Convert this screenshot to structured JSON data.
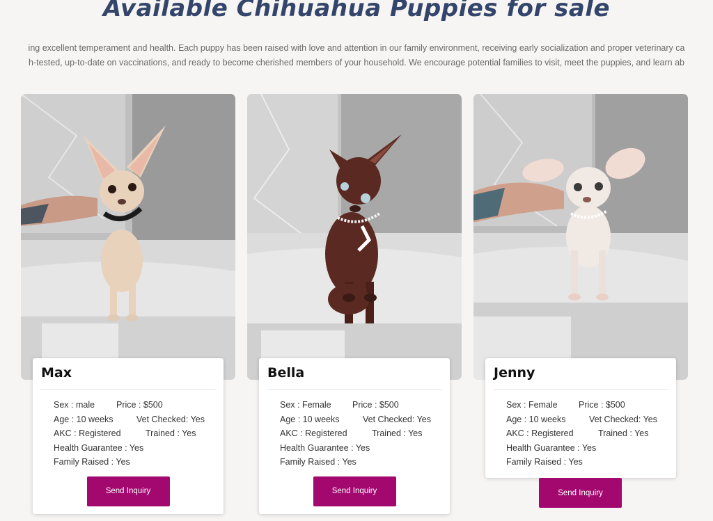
{
  "page": {
    "title": "Available Chihuahua Puppies for sale",
    "intro_line1": "ing excellent temperament and health. Each puppy has been raised with love and attention in our family environment, receiving early socialization and proper veterinary ca",
    "intro_line2": "h-tested, up-to-date on vaccinations, and ready to become cherished members of your household. We encourage potential families to visit, meet the puppies, and learn ab"
  },
  "puppies": [
    {
      "name": "Max",
      "sex": "Sex : male",
      "price": "Price : $500",
      "age": "Age : 10 weeks",
      "vet": "Vet Checked: Yes",
      "akc": "AKC : Registered",
      "trained": "Trained : Yes",
      "guarantee": "Health Guarantee : Yes",
      "family": "Family Raised : Yes",
      "button": "Send Inquiry",
      "coat_color": "#e8d2bc"
    },
    {
      "name": "Bella",
      "sex": "Sex : Female",
      "price": "Price : $500",
      "age": "Age : 10 weeks",
      "vet": "Vet Checked: Yes",
      "akc": "AKC : Registered",
      "trained": "Trained : Yes",
      "guarantee": "Health Guarantee : Yes",
      "family": "Family Raised : Yes",
      "button": "Send Inquiry",
      "coat_color": "#5a2a22"
    },
    {
      "name": "Jenny",
      "sex": "Sex : Female",
      "price": "Price : $500",
      "age": "Age : 10 weeks",
      "vet": "Vet Checked: Yes",
      "akc": "AKC : Registered",
      "trained": "Trained : Yes",
      "guarantee": "Health Guarantee : Yes",
      "family": "Family Raised : Yes",
      "button": "Send Inquiry",
      "coat_color": "#f1e9e4"
    }
  ],
  "colors": {
    "title": "#33456a",
    "button": "#a3086f",
    "background": "#f7f5f3"
  }
}
